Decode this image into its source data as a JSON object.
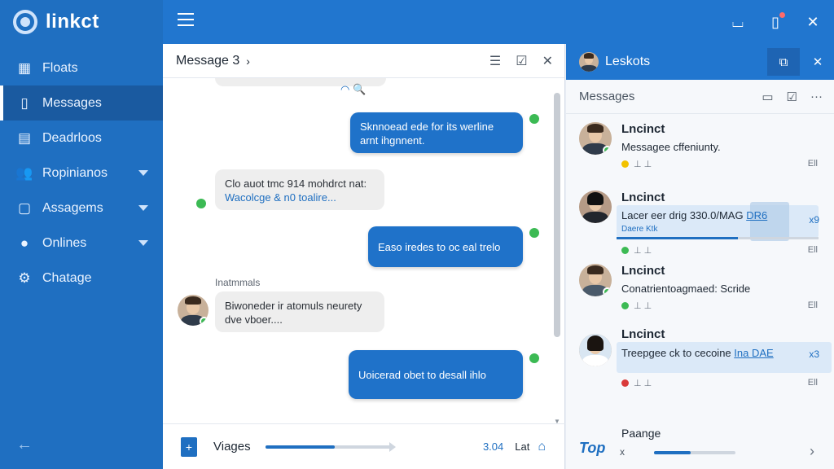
{
  "app": {
    "name": "linkct"
  },
  "sidebar": {
    "items": [
      {
        "label": "Floats",
        "icon": "grid-icon",
        "active": false,
        "caret": false
      },
      {
        "label": "Messages",
        "icon": "message-icon",
        "active": true,
        "caret": false
      },
      {
        "label": "Deadrloos",
        "icon": "document-icon",
        "active": false,
        "caret": false
      },
      {
        "label": "Ropinianos",
        "icon": "users-icon",
        "active": false,
        "caret": true
      },
      {
        "label": "Assagems",
        "icon": "file-icon",
        "active": false,
        "caret": true
      },
      {
        "label": "Onlines",
        "icon": "pin-icon",
        "active": false,
        "caret": true
      },
      {
        "label": "Chatage",
        "icon": "gear-icon",
        "active": false,
        "caret": false
      }
    ],
    "collapse_glyph": "←"
  },
  "chat": {
    "title": "Message 3",
    "messages": [
      {
        "dir": "out",
        "line1": "Sknnoead ede for its werline",
        "line2": "arnt ihgnnent."
      },
      {
        "dir": "in",
        "line1": "Clo auot tmc 914 mohdrct nat:",
        "line2": "Wacolcge & n0 toalire..."
      },
      {
        "dir": "out",
        "line1": "Easo iredes to oc eal trelo",
        "line2": ""
      },
      {
        "dir": "in",
        "sender": "Inatmmals",
        "line1": "Biwoneder ir atomuls neurety",
        "line2": "dve vboer...."
      },
      {
        "dir": "out",
        "line1": "Uoicerad obet to desall ihlo",
        "line2": ""
      }
    ],
    "footer": {
      "file_name": "Viages",
      "progress": 0.55,
      "size": "3.04",
      "unit": "Lat"
    }
  },
  "right_panel": {
    "title": "Leskots",
    "subtitle": "Messages",
    "contacts": [
      {
        "name": "Lncinct",
        "message": "Messagee cffeniunty.",
        "status_color": "#f2c200",
        "count": "Ell",
        "badge": ""
      },
      {
        "name": "Lncinct",
        "message": "Lacer eer drig 330.0/MAG",
        "link": "DR6",
        "sub": "Daere Ktk",
        "status_color": "#3cba54",
        "count": "Ell",
        "badge": "x9",
        "progress": 0.6
      },
      {
        "name": "Lncinct",
        "message": "Conatrientoagmaed: Scride",
        "status_color": "#3cba54",
        "count": "Ell",
        "badge": ""
      },
      {
        "name": "Lncinct",
        "message": "Treepgee ck to cecoine",
        "link": "Ina DAE",
        "status_color": "#d93a3a",
        "count": "Ell",
        "badge": "x3"
      }
    ],
    "pager": {
      "top_label": "Top",
      "label": "Paange",
      "x_label": "x",
      "progress": 0.45
    }
  }
}
